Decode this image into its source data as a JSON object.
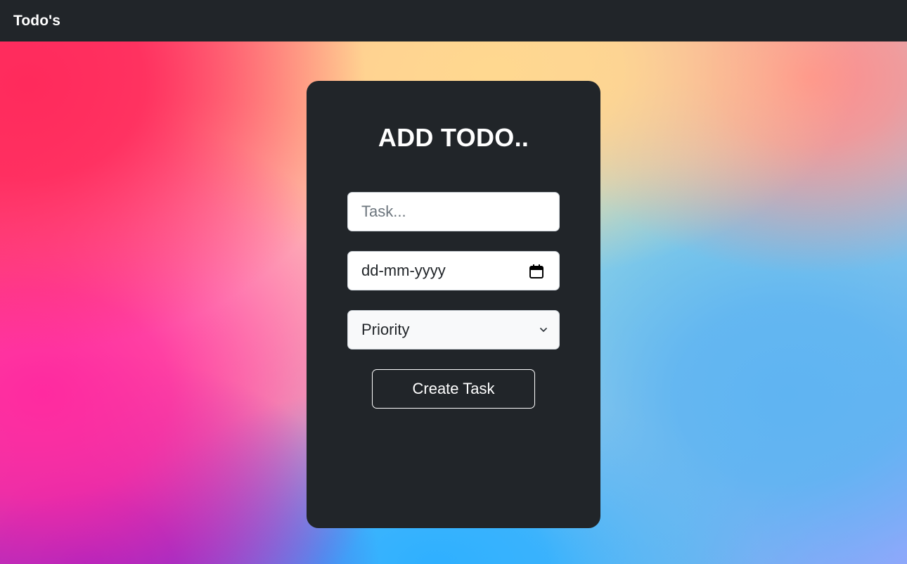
{
  "navbar": {
    "brand": "Todo's"
  },
  "form": {
    "title": "ADD TODO..",
    "task_placeholder": "Task...",
    "date_placeholder": "dd-mm-yyyy",
    "priority_selected": "Priority",
    "submit_label": "Create Task"
  },
  "icons": {
    "date_picker": "calendar-icon",
    "select_arrow": "chevron-down-icon"
  },
  "colors": {
    "navbar_bg": "#212529",
    "card_bg": "#212529",
    "text_light": "#ffffff",
    "placeholder": "#6c757d",
    "input_border": "#ced4da",
    "select_bg": "#f8f9fa"
  }
}
